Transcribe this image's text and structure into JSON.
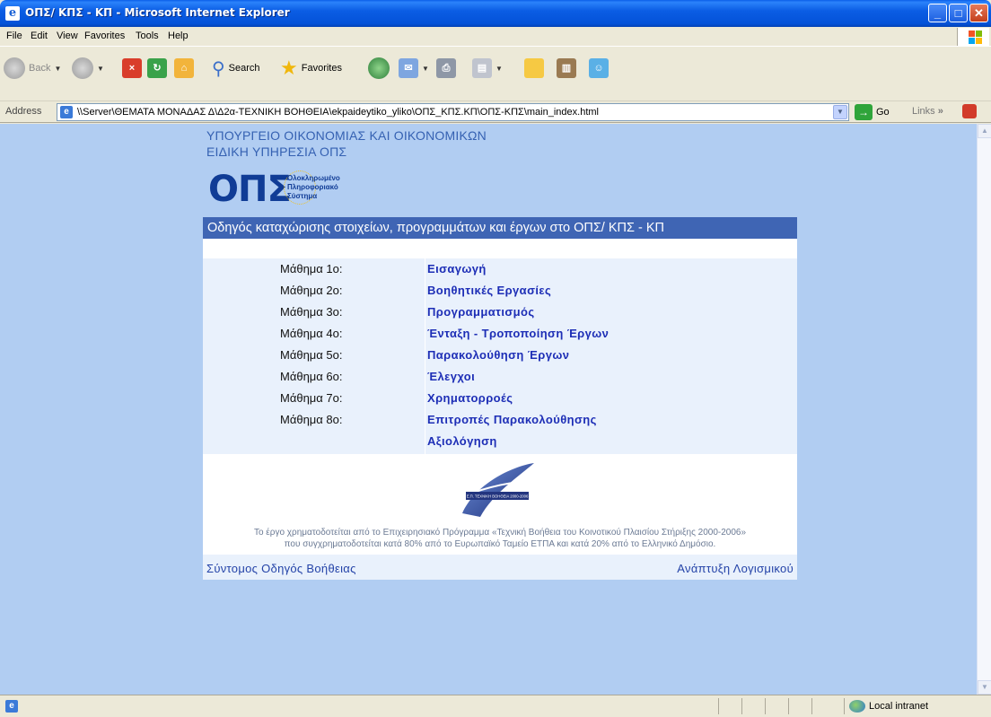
{
  "window": {
    "title": "ΟΠΣ/ ΚΠΣ - ΚΠ - Microsoft Internet Explorer",
    "buttons": {
      "minimize": "_",
      "maximize": "□",
      "close": "✕"
    }
  },
  "menu": [
    "File",
    "Edit",
    "View",
    "Favorites",
    "Tools",
    "Help"
  ],
  "toolbar": {
    "back_label": "Back",
    "search_label": "Search",
    "favorites_label": "Favorites"
  },
  "address": {
    "label": "Address",
    "url": "\\\\Server\\ΘΕΜΑΤΑ ΜΟΝΑΔΑΣ Δ\\Δ2α-ΤΕΧΝΙΚΗ ΒΟΗΘΕΙΑ\\ekpaideytiko_yliko\\ΟΠΣ_ΚΠΣ.ΚΠ\\ΟΠΣ-ΚΠΣ\\main_index.html",
    "go_label": "Go",
    "links_label": "Links"
  },
  "page": {
    "ministry_line1": "ΥΠΟΥΡΓΕΙΟ ΟΙΚΟΝΟΜΙΑΣ ΚΑΙ ΟΙΚΟΝΟΜΙΚΩΝ",
    "ministry_line2": "ΕΙΔΙΚΗ ΥΠΗΡΕΣΙΑ ΟΠΣ",
    "logo_text": "ΟΠΣ",
    "logo_sub1": "Ολοκληρωμένο",
    "logo_sub2": "Πληροφοριακό",
    "logo_sub3": "Σύστημα",
    "banner": "Οδηγός καταχώρισης στοιχείων, προγραμμάτων και έργων στο ΟΠΣ/ ΚΠΣ - ΚΠ",
    "lessons": [
      {
        "num": "Μάθημα 1ο:",
        "title": "Εισαγωγή"
      },
      {
        "num": "Μάθημα 2ο:",
        "title": "Βοηθητικές Εργασίες"
      },
      {
        "num": "Μάθημα 3ο:",
        "title": "Προγραμματισμός"
      },
      {
        "num": "Μάθημα 4ο:",
        "title": "Ένταξη - Τροποποίηση Έργων"
      },
      {
        "num": "Μάθημα 5ο:",
        "title": "Παρακολούθηση Έργων"
      },
      {
        "num": "Μάθημα 6ο:",
        "title": "Έλεγχοι"
      },
      {
        "num": "Μάθημα 7ο:",
        "title": "Χρηματορροές"
      },
      {
        "num": "Μάθημα 8ο:",
        "title": "Επιτροπές Παρακολούθησης"
      },
      {
        "num": "",
        "title": "Αξιολόγηση"
      }
    ],
    "ta_logo_text": "Ε.Π. ΤΕΧΝΙΚΗ ΒΟΗΘΕΙΑ 2000-2006",
    "funding_line1": "Το έργο χρηματοδοτείται από το Επιχειρησιακό Πρόγραμμα «Τεχνική Βοήθεια του Κοινοτικού Πλαισίου Στήριξης 2000-2006»",
    "funding_line2": "που συγχρηματοδοτείται κατά 80% από το Ευρωπαϊκό Ταμείο ΕΤΠΑ και κατά 20% από το Ελληνικό Δημόσιο.",
    "help_link": "Σύντομος Οδηγός Βοήθειας",
    "dev_link": "Ανάπτυξη Λογισμικού"
  },
  "status": {
    "zone": "Local intranet"
  },
  "colors": {
    "page_bg": "#b1cdf2",
    "banner_bg": "#3f65b4",
    "link": "#1d2eb6",
    "ministry_text": "#3561b2"
  }
}
